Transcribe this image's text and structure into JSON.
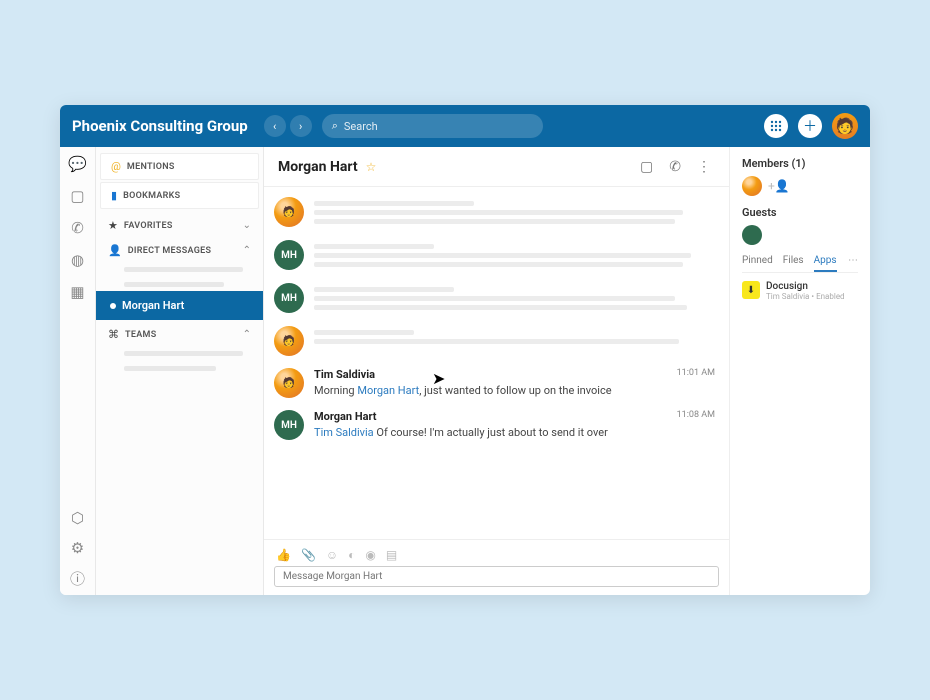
{
  "header": {
    "title": "Phoenix Consulting Group",
    "search_placeholder": "Search"
  },
  "sidebar": {
    "mentions_label": "MENTIONS",
    "bookmarks_label": "BOOKMARKS",
    "favorites_label": "FAVORITES",
    "dms_label": "DIRECT MESSAGES",
    "active_dm": "Morgan Hart",
    "teams_label": "TEAMS"
  },
  "conversation": {
    "title": "Morgan Hart",
    "messages": [
      {
        "sender": "Tim Saldivia",
        "time": "11:01 AM",
        "prefix": "Morning ",
        "mention": "Morgan Hart",
        "suffix": ", just wanted to follow up on the invoice"
      },
      {
        "sender": "Morgan Hart",
        "time": "11:08 AM",
        "prefix": "",
        "mention": "Tim Saldivia",
        "suffix": " Of course! I'm actually just about to send it over"
      }
    ],
    "composer_placeholder": "Message Morgan Hart"
  },
  "right": {
    "members_label": "Members (1)",
    "guests_label": "Guests",
    "tabs": {
      "pinned": "Pinned",
      "files": "Files",
      "apps": "Apps"
    },
    "app": {
      "name": "Docusign",
      "sub": "Tim Saldivia • Enabled"
    }
  }
}
